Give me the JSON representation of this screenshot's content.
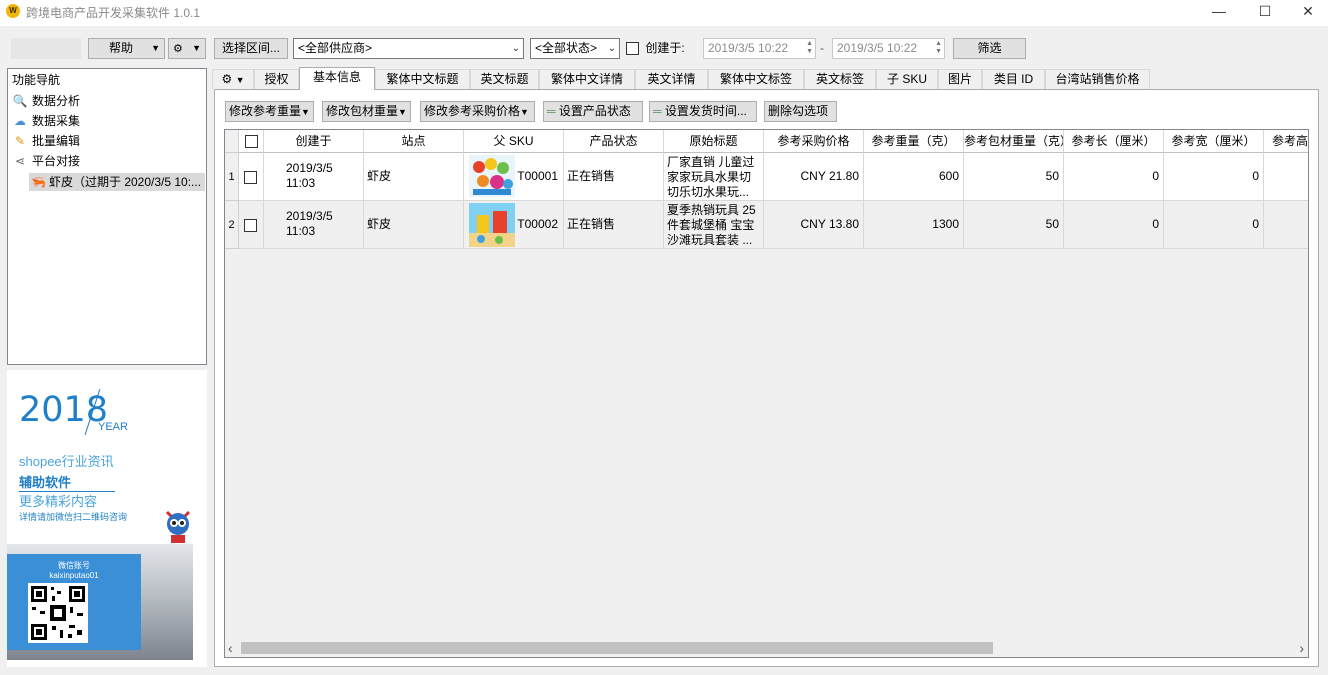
{
  "window": {
    "title": "跨境电商产品开发采集软件 1.0.1",
    "icon_text": "W",
    "min": "—",
    "max": "☐",
    "close": "✕"
  },
  "toolbar": {
    "help": "帮助",
    "select_range": "选择区间...",
    "supplier": "<全部供应商>",
    "status": "<全部状态>",
    "created_label": "创建于:",
    "date_from": "2019/3/5 10:22",
    "date_sep": "-",
    "date_to": "2019/3/5 10:22",
    "filter": "筛选"
  },
  "nav": {
    "title": "功能导航",
    "items": [
      {
        "label": "数据分析",
        "icon": "magnifier-icon"
      },
      {
        "label": "数据采集",
        "icon": "cloud-icon"
      },
      {
        "label": "批量编辑",
        "icon": "pencil-icon"
      },
      {
        "label": "平台对接",
        "icon": "share-icon"
      }
    ],
    "sub_item": "虾皮（过期于 2020/3/5 10:..."
  },
  "ad": {
    "year": "2018",
    "year_label": "YEAR",
    "line1": "shopee行业资讯",
    "line2": "辅助软件",
    "line3": "更多精彩内容",
    "line4": "详情请加微信扫二维码咨询",
    "wechat_title": "微信账号",
    "wechat_id": "kaixinputao01"
  },
  "tabs": [
    "授权",
    "基本信息",
    "繁体中文标题",
    "英文标题",
    "繁体中文详情",
    "英文详情",
    "繁体中文标签",
    "英文标签",
    "子 SKU",
    "图片",
    "类目 ID",
    "台湾站销售价格"
  ],
  "active_tab": 1,
  "table_toolbar": {
    "edit_weight": "修改参考重量",
    "edit_pack_weight": "修改包材重量",
    "edit_price": "修改参考采购价格",
    "set_status": "设置产品状态",
    "set_ship_time": "设置发货时间...",
    "delete_checked": "删除勾选项"
  },
  "table": {
    "columns": [
      "",
      "创建于",
      "站点",
      "父 SKU",
      "产品状态",
      "原始标题",
      "参考采购价格",
      "参考重量（克）",
      "参考包材重量（克）",
      "参考长（厘米）",
      "参考宽（厘米）",
      "参考高（厘米）"
    ],
    "rows": [
      {
        "num": "1",
        "date": "2019/3/5",
        "time": "11:03",
        "site": "虾皮",
        "sku": "T00001",
        "status": "正在销售",
        "title": "厂家直销 儿童过家家玩具水果切切乐切水果玩...",
        "price": "CNY 21.80",
        "weight": "600",
        "pack": "50",
        "len": "0",
        "wid": "0",
        "hei": ""
      },
      {
        "num": "2",
        "date": "2019/3/5",
        "time": "11:03",
        "site": "虾皮",
        "sku": "T00002",
        "status": "正在销售",
        "title": "夏季热销玩具 25件套城堡桶 宝宝沙滩玩具套装 ...",
        "price": "CNY 13.80",
        "weight": "1300",
        "pack": "50",
        "len": "0",
        "wid": "0",
        "hei": ""
      }
    ]
  },
  "scroll": {
    "left": "‹",
    "right": "›"
  }
}
